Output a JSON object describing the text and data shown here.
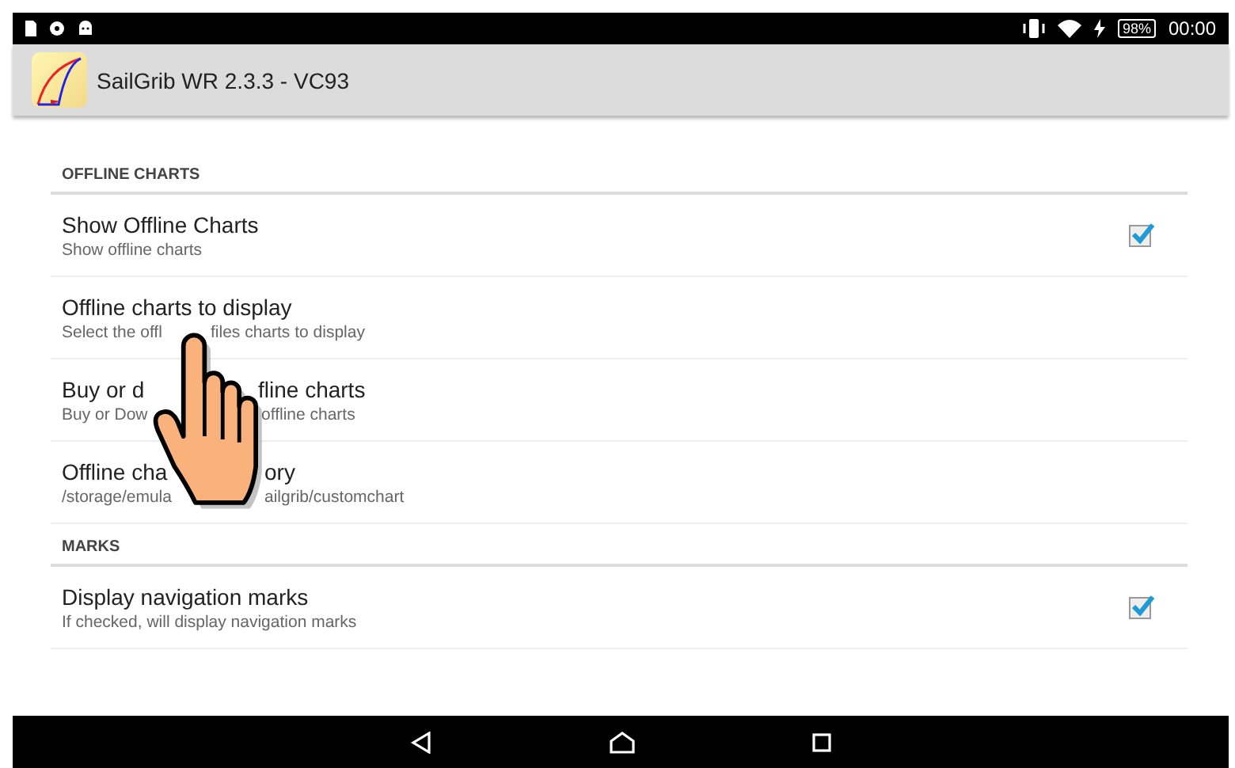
{
  "status_bar": {
    "battery": "98%",
    "time": "00:00"
  },
  "app_bar": {
    "title": "SailGrib WR 2.3.3 - VC93"
  },
  "sections": [
    {
      "header": "OFFLINE CHARTS",
      "items": [
        {
          "kind": "checkbox",
          "title": [
            "Show Offline Charts"
          ],
          "summary": [
            "Show offline charts"
          ],
          "checked": true
        },
        {
          "kind": "plain",
          "title": [
            "Offline charts to display"
          ],
          "summary": [
            "Select the offl",
            "files charts to display"
          ]
        },
        {
          "kind": "plain",
          "title": [
            "Buy or d",
            "fline charts"
          ],
          "summary": [
            "Buy or Dow",
            "offline charts"
          ]
        },
        {
          "kind": "plain",
          "title": [
            "Offline cha",
            "ory"
          ],
          "summary": [
            "/storage/emula",
            "ailgrib/customchart"
          ]
        }
      ]
    },
    {
      "header": "MARKS",
      "items": [
        {
          "kind": "checkbox",
          "title": [
            "Display navigation marks"
          ],
          "summary": [
            "If checked, will display navigation marks"
          ],
          "checked": true
        }
      ]
    }
  ]
}
